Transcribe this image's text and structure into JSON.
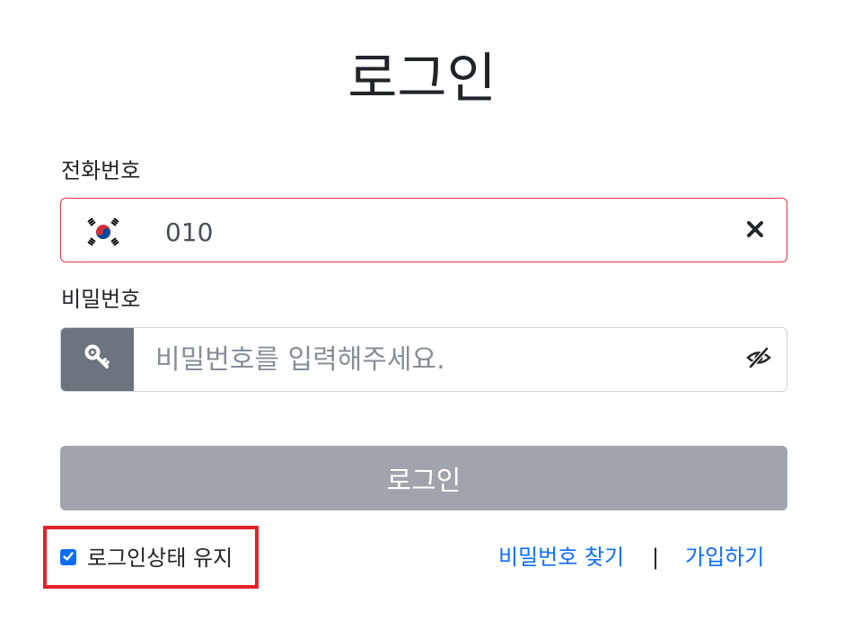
{
  "page": {
    "title": "로그인"
  },
  "phone": {
    "label": "전화번호",
    "value": "010",
    "country_icon": "korea-flag-icon",
    "clear_icon": "close-icon"
  },
  "password": {
    "label": "비밀번호",
    "placeholder": "비밀번호를 입력해주세요.",
    "addon_icon": "key-icon",
    "toggle_icon": "eye-slash-icon"
  },
  "login_button": {
    "label": "로그인"
  },
  "keep_login": {
    "label": "로그인상태 유지",
    "checked": true
  },
  "links": {
    "find_password": "비밀번호 찾기",
    "separator": "|",
    "signup": "가입하기"
  },
  "colors": {
    "primary": "#0d6efd",
    "invalid_border": "#dc3545",
    "disabled_button": "#a0a5ad",
    "addon_bg": "#6c757d",
    "highlight_box": "#e5202a"
  }
}
